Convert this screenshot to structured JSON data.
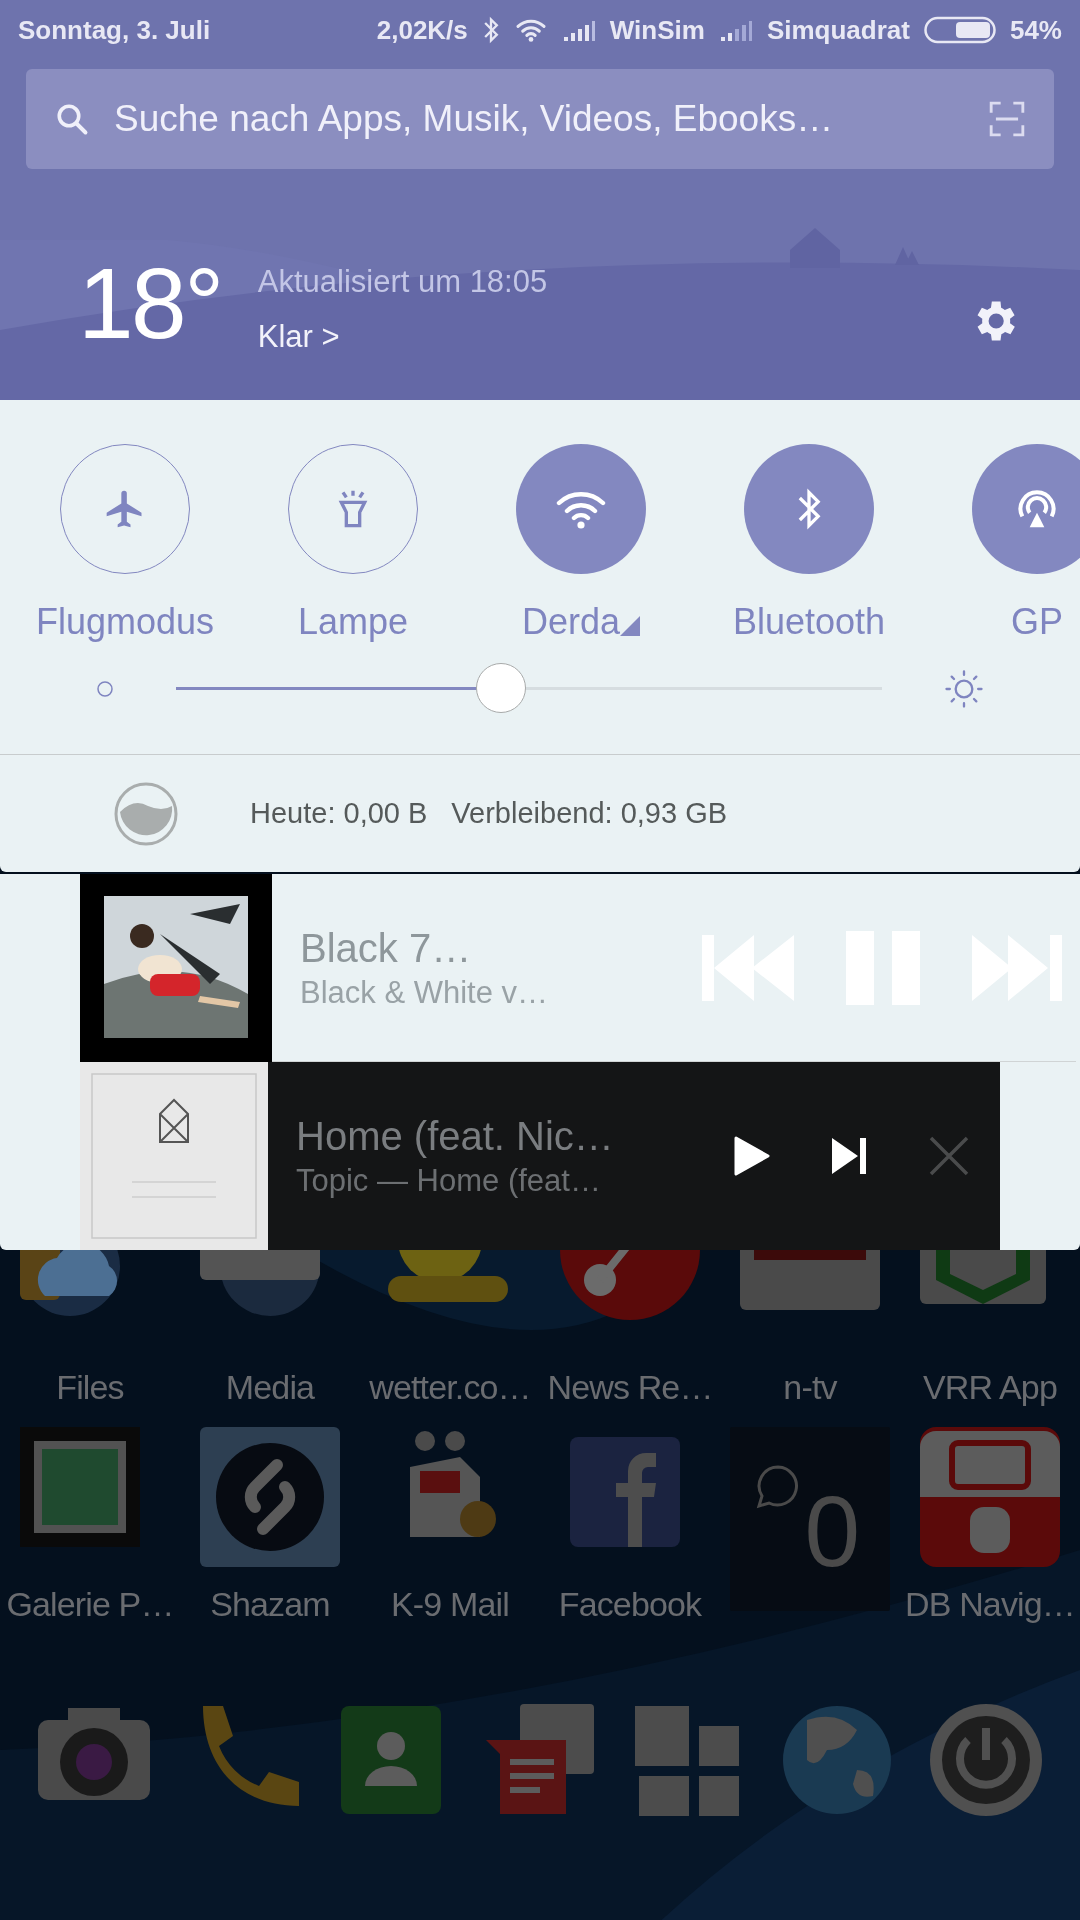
{
  "status_bar": {
    "date": "Sonntag, 3. Juli",
    "speed": "2,02K/s",
    "carrier_1": "WinSim",
    "carrier_2": "Simquadrat",
    "battery": "54%"
  },
  "search": {
    "placeholder": "Suche nach Apps, Musik, Videos, Ebooks…"
  },
  "weather": {
    "temperature": "18°",
    "updated": "Aktualisiert um 18:05",
    "condition": "Klar >"
  },
  "toggles": [
    {
      "label": "Flugmodus",
      "on": false
    },
    {
      "label": "Lampe",
      "on": false
    },
    {
      "label": "Derda",
      "on": true
    },
    {
      "label": "Bluetooth",
      "on": true
    },
    {
      "label": "GP",
      "on": true
    }
  ],
  "brightness": {
    "level": 0.46
  },
  "data_usage": {
    "today": "Heute: 0,00 B",
    "remaining": "Verbleibend: 0,93 GB"
  },
  "media": [
    {
      "title": "Black 7…",
      "subtitle": "Black & White v…",
      "playing": true
    },
    {
      "title": "Home (feat. Nic…",
      "subtitle": "Topic — Home (feat…",
      "playing": false
    }
  ],
  "home": {
    "apps": [
      {
        "label": "Files"
      },
      {
        "label": "Media"
      },
      {
        "label": "wetter.co…"
      },
      {
        "label": "News Re…"
      },
      {
        "label": "n-tv"
      },
      {
        "label": "VRR App"
      },
      {
        "label": "Galerie P…"
      },
      {
        "label": "Shazam"
      },
      {
        "label": "K-9 Mail"
      },
      {
        "label": "Facebook"
      },
      {
        "kind": "widget",
        "count": "0"
      },
      {
        "label": "DB Navig…"
      }
    ]
  }
}
